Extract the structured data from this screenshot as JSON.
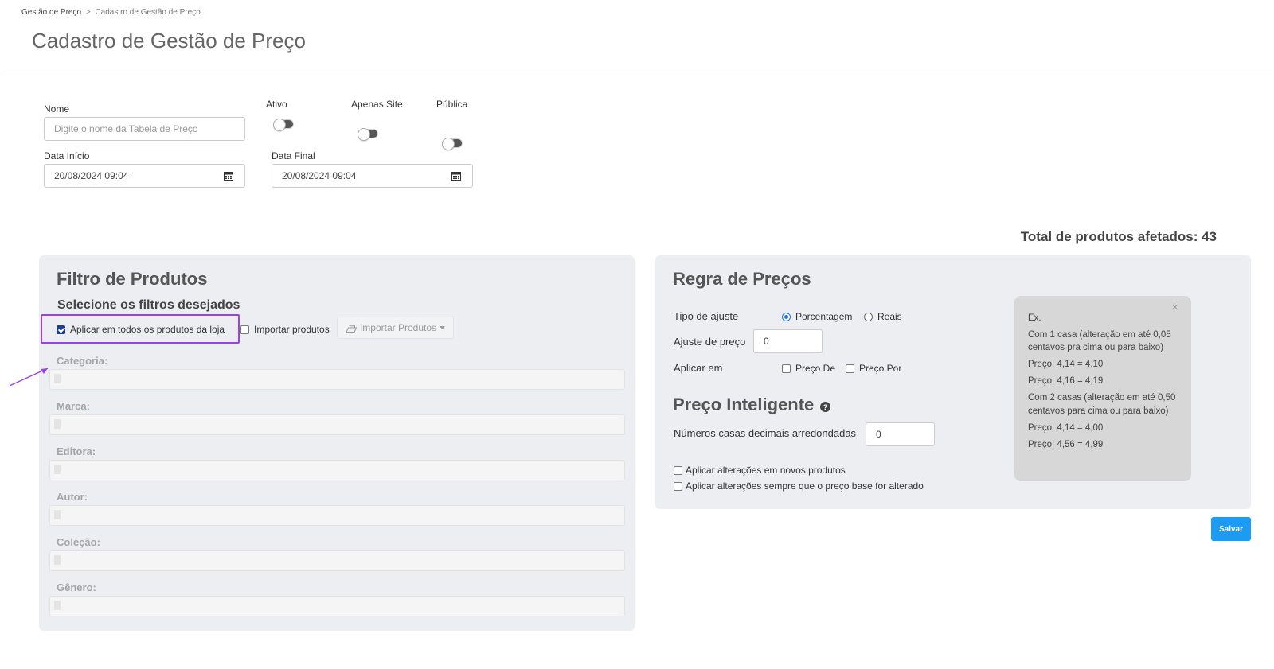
{
  "breadcrumb": {
    "parent": "Gestão de Preço",
    "separator": ">",
    "current": "Cadastro de Gestão de Preço"
  },
  "page": {
    "title": "Cadastro de Gestão de Preço"
  },
  "form": {
    "name_label": "Nome",
    "name_placeholder": "Digite o nome da Tabela de Preço",
    "ativo_label": "Ativo",
    "apenas_site_label": "Apenas Site",
    "publica_label": "Pública",
    "data_inicio_label": "Data Início",
    "data_inicio_value": "20/08/2024 09:04",
    "data_final_label": "Data Final",
    "data_final_value": "20/08/2024 09:04"
  },
  "total": {
    "text": "Total de produtos afetados: 43"
  },
  "filtro": {
    "title": "Filtro de Produtos",
    "subtitle": "Selecione os filtros desejados",
    "apply_all_label": "Aplicar em todos os produtos da loja",
    "apply_all_checked": true,
    "import_label": "Importar produtos",
    "import_checked": false,
    "import_button_label": "Importar Produtos",
    "filters": [
      {
        "label": "Categoria:"
      },
      {
        "label": "Marca:"
      },
      {
        "label": "Editora:"
      },
      {
        "label": "Autor:"
      },
      {
        "label": "Coleção:"
      },
      {
        "label": "Gênero:"
      }
    ]
  },
  "regra": {
    "title": "Regra de Preços",
    "tipo_ajuste_label": "Tipo de ajuste",
    "option_porcentagem": "Porcentagem",
    "option_reais": "Reais",
    "selected_tipo": "Porcentagem",
    "ajuste_label": "Ajuste de preço",
    "ajuste_value": "0",
    "aplicar_em_label": "Aplicar em",
    "preco_de_label": "Preço De",
    "preco_por_label": "Preço Por",
    "inteligente_title": "Preço Inteligente",
    "casas_label": "Números casas decimais arredondadas",
    "casas_value": "0",
    "novos_produtos_label": "Aplicar alterações em novos produtos",
    "preco_base_label": "Aplicar alterações sempre que o preço base for alterado"
  },
  "tooltip": {
    "close": "×",
    "lines": [
      "Ex.",
      "Com 1 casa (alteração em até 0,05 centavos pra cima ou para baixo)",
      "Preço: 4,14 = 4,10",
      "Preço: 4,16 = 4,19",
      "Com 2 casas (alteração em até 0,50 centavos para cima ou para baixo)",
      "Preço: 4,14 = 4,00",
      "Preço: 4,56 = 4,99"
    ]
  },
  "actions": {
    "save_label": "Salvar"
  },
  "colors": {
    "accent": "#1b9cf2",
    "annotation": "#9b3ff0",
    "panel_bg": "#eceef2"
  }
}
